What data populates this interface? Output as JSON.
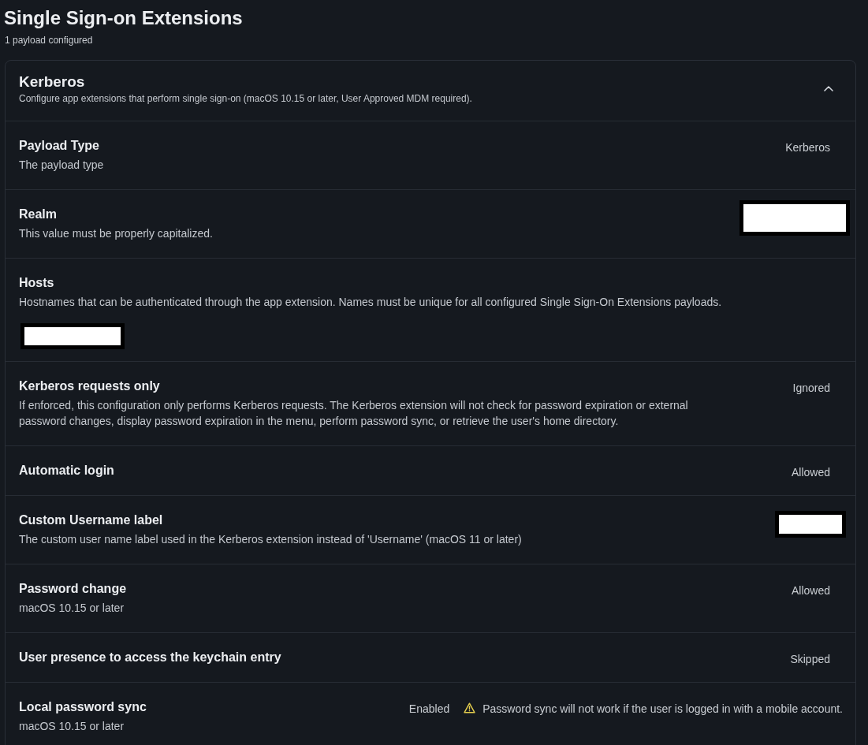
{
  "page": {
    "title": "Single Sign-on Extensions",
    "subtitle": "1 payload configured"
  },
  "payload": {
    "title": "Kerberos",
    "description": "Configure app extensions that perform single sign-on (macOS 10.15 or later, User Approved MDM required).",
    "expanded": true,
    "settings": [
      {
        "kind": "text",
        "label": "Payload Type",
        "description": "The payload type",
        "value": "Kerberos"
      },
      {
        "kind": "redacted",
        "label": "Realm",
        "description": "This value must be properly capitalized."
      },
      {
        "kind": "redacted_below",
        "label": "Hosts",
        "description": "Hostnames that can be authenticated through the app extension. Names must be unique for all configured Single Sign-On Extensions payloads."
      },
      {
        "kind": "text",
        "label": "Kerberos requests only",
        "description": "If enforced, this configuration only performs Kerberos requests. The Kerberos extension will not check for password expiration or external password changes, display password expiration in the menu, perform password sync, or retrieve the user's home directory.",
        "value": "Ignored"
      },
      {
        "kind": "text",
        "label": "Automatic login",
        "value": "Allowed"
      },
      {
        "kind": "redacted",
        "label": "Custom Username label",
        "description": "The custom user name label used in the Kerberos extension instead of 'Username' (macOS 11 or later)"
      },
      {
        "kind": "text",
        "label": "Password change",
        "description": "macOS 10.15 or later",
        "value": "Allowed"
      },
      {
        "kind": "text",
        "label": "User presence to access the keychain entry",
        "value": "Skipped"
      },
      {
        "kind": "warning",
        "label": "Local password sync",
        "description": "macOS 10.15 or later",
        "value": "Enabled",
        "warning": "Password sync will not work if the user is logged in with a mobile account."
      }
    ]
  }
}
